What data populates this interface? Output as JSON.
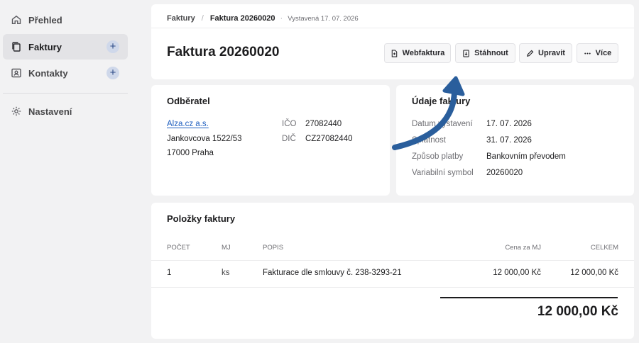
{
  "sidebar": {
    "items": [
      {
        "label": "Přehled",
        "icon": "home-icon"
      },
      {
        "label": "Faktury",
        "icon": "documents-icon",
        "active": true
      },
      {
        "label": "Kontakty",
        "icon": "contact-card-icon"
      },
      {
        "label": "Nastavení",
        "icon": "gear-icon"
      }
    ],
    "plus": "+"
  },
  "header": {
    "breadcrumb": {
      "root": "Faktury",
      "sep": "/",
      "current": "Faktura 20260020",
      "dot": "·",
      "issued": "Vystavená 17. 07. 2026"
    },
    "title": "Faktura 20260020",
    "actions": {
      "web": "Webfaktura",
      "download": "Stáhnout",
      "edit": "Upravit",
      "more": "Více"
    }
  },
  "customer": {
    "title": "Odběratel",
    "name": "Alza.cz a.s.",
    "street": "Jankovcova 1522/53",
    "city": "17000 Praha",
    "ico_label": "IČO",
    "ico": "27082440",
    "dic_label": "DIČ",
    "dic": "CZ27082440"
  },
  "details": {
    "title": "Údaje faktury",
    "rows": [
      {
        "label": "Datum vystavení",
        "value": "17. 07. 2026"
      },
      {
        "label": "Splatnost",
        "value": "31. 07. 2026"
      },
      {
        "label": "Způsob platby",
        "value": "Bankovním převodem"
      },
      {
        "label": "Variabilní symbol",
        "value": "20260020"
      }
    ]
  },
  "items": {
    "title": "Položky faktury",
    "columns": {
      "qty": "POČET",
      "unit": "MJ",
      "desc": "POPIS",
      "price": "Cena za MJ",
      "total": "CELKEM"
    },
    "rows": [
      {
        "qty": "1",
        "unit": "ks",
        "desc": "Fakturace dle smlouvy č. 238-3293-21",
        "price": "12 000,00 Kč",
        "total": "12 000,00 Kč"
      }
    ],
    "grand_total": "12 000,00 Kč"
  },
  "colors": {
    "accent": "#1f5fbf",
    "arrow": "#2a5e9c",
    "active_nav": "#e3e3e6"
  }
}
